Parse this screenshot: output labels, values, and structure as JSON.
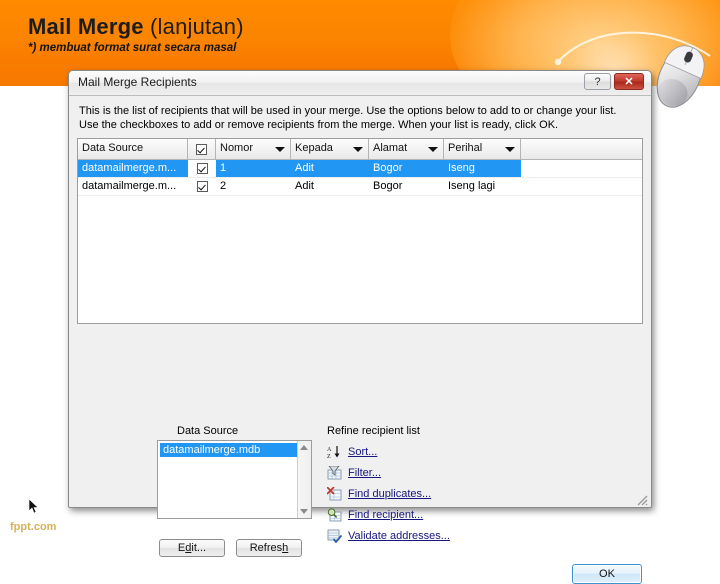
{
  "slide": {
    "title_bold": "Mail Merge",
    "title_normal": " (lanjutan)",
    "subtitle": "*) membuat format surat secara masal",
    "watermark": "fppt.com"
  },
  "dialog": {
    "title": "Mail Merge Recipients",
    "help_button": "?",
    "close_button": "✕",
    "intro": "This is the list of recipients that will be used in your merge.  Use the options below to add to or change your list.  Use the checkboxes to add or remove recipients from the merge.  When your list is ready, click OK.",
    "ok_button": "OK"
  },
  "grid": {
    "columns": [
      {
        "label": "Data Source",
        "type": "text",
        "width": 110,
        "dropdown": false
      },
      {
        "label": "",
        "type": "checkbox",
        "width": 28,
        "dropdown": false
      },
      {
        "label": "Nomor",
        "type": "text",
        "width": 75,
        "dropdown": true
      },
      {
        "label": "Kepada",
        "type": "text",
        "width": 78,
        "dropdown": true
      },
      {
        "label": "Alamat",
        "type": "text",
        "width": 75,
        "dropdown": true
      },
      {
        "label": "Perihal",
        "type": "text",
        "width": 77,
        "dropdown": true
      }
    ],
    "header_checkbox_checked": true,
    "rows": [
      {
        "selected": true,
        "checked": true,
        "data_source": "datamailmerge.m...",
        "nomor": "1",
        "kepada": "Adit",
        "alamat": "Bogor",
        "perihal": "Iseng"
      },
      {
        "selected": false,
        "checked": true,
        "data_source": "datamailmerge.m...",
        "nomor": "2",
        "kepada": "Adit",
        "alamat": "Bogor",
        "perihal": "Iseng lagi"
      }
    ]
  },
  "data_source_panel": {
    "label": "Data Source",
    "items": [
      "datamailmerge.mdb"
    ],
    "selected_item": "datamailmerge.mdb",
    "edit_button": {
      "pre": "E",
      "accel": "d",
      "post": "it..."
    },
    "refresh_button": {
      "pre": "Refres",
      "accel": "h",
      "post": ""
    }
  },
  "refine_panel": {
    "label": "Refine recipient list",
    "links": [
      {
        "label": "Sort...",
        "icon": "sort-az-icon"
      },
      {
        "label": "Filter...",
        "icon": "funnel-filter-icon"
      },
      {
        "label": "Find duplicates...",
        "icon": "find-duplicates-icon"
      },
      {
        "label": "Find recipient...",
        "icon": "find-recipient-icon"
      },
      {
        "label": "Validate addresses...",
        "icon": "validate-addresses-icon"
      }
    ]
  },
  "colors": {
    "banner_orange": "#fb8400",
    "selection_blue": "#2196f3",
    "link_blue": "#16167e",
    "watermark_gold": "#d7b25a",
    "close_red": "#c23b2e"
  }
}
